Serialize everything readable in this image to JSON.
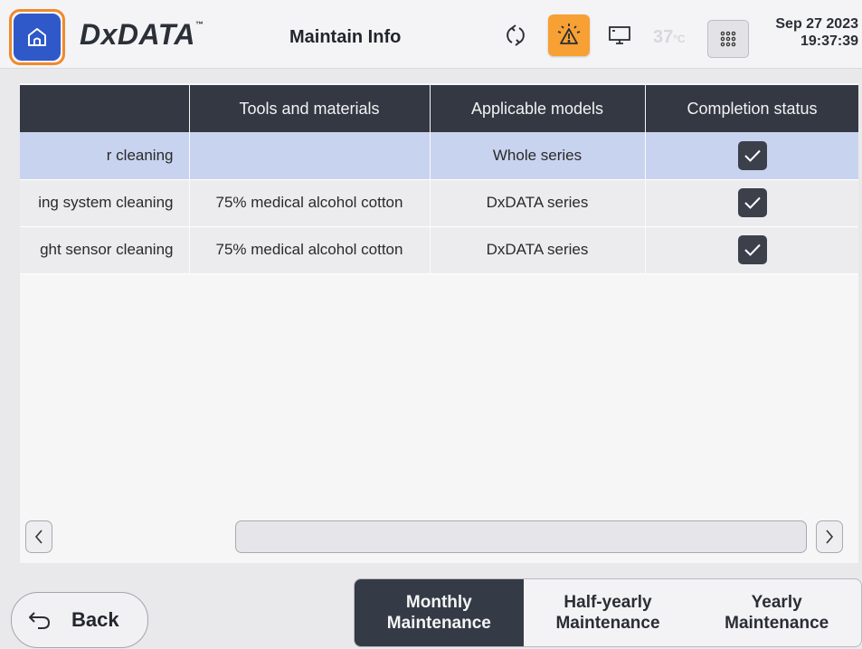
{
  "header": {
    "logo": "DxDATA",
    "logo_mark": "™",
    "title": "Maintain Info",
    "temperature": "37",
    "temperature_unit": "°C",
    "date": "Sep 27 2023",
    "time": "19:37:39",
    "icons": [
      "home-icon",
      "sync-icon",
      "alarm-icon",
      "monitor-icon",
      "keypad-icon"
    ],
    "alarm_color": "#f7a033",
    "accent_color": "#2f58c9"
  },
  "table": {
    "columns": [
      "",
      "Tools and materials",
      "Applicable models",
      "Completion status"
    ],
    "rows": [
      {
        "item": "r cleaning",
        "tools": "",
        "models": "Whole series",
        "completed": true,
        "selected": true
      },
      {
        "item": "ing system cleaning",
        "tools": "75% medical alcohol cotton",
        "models": "DxDATA series",
        "completed": true,
        "selected": false
      },
      {
        "item": "ght sensor cleaning",
        "tools": "75% medical alcohol cotton",
        "models": "DxDATA series",
        "completed": true,
        "selected": false
      }
    ]
  },
  "footer": {
    "back_label": "Back",
    "tabs": [
      {
        "line1": "Monthly",
        "line2": "Maintenance",
        "active": true
      },
      {
        "line1": "Half-yearly",
        "line2": "Maintenance",
        "active": false
      },
      {
        "line1": "Yearly",
        "line2": "Maintenance",
        "active": false
      }
    ]
  }
}
